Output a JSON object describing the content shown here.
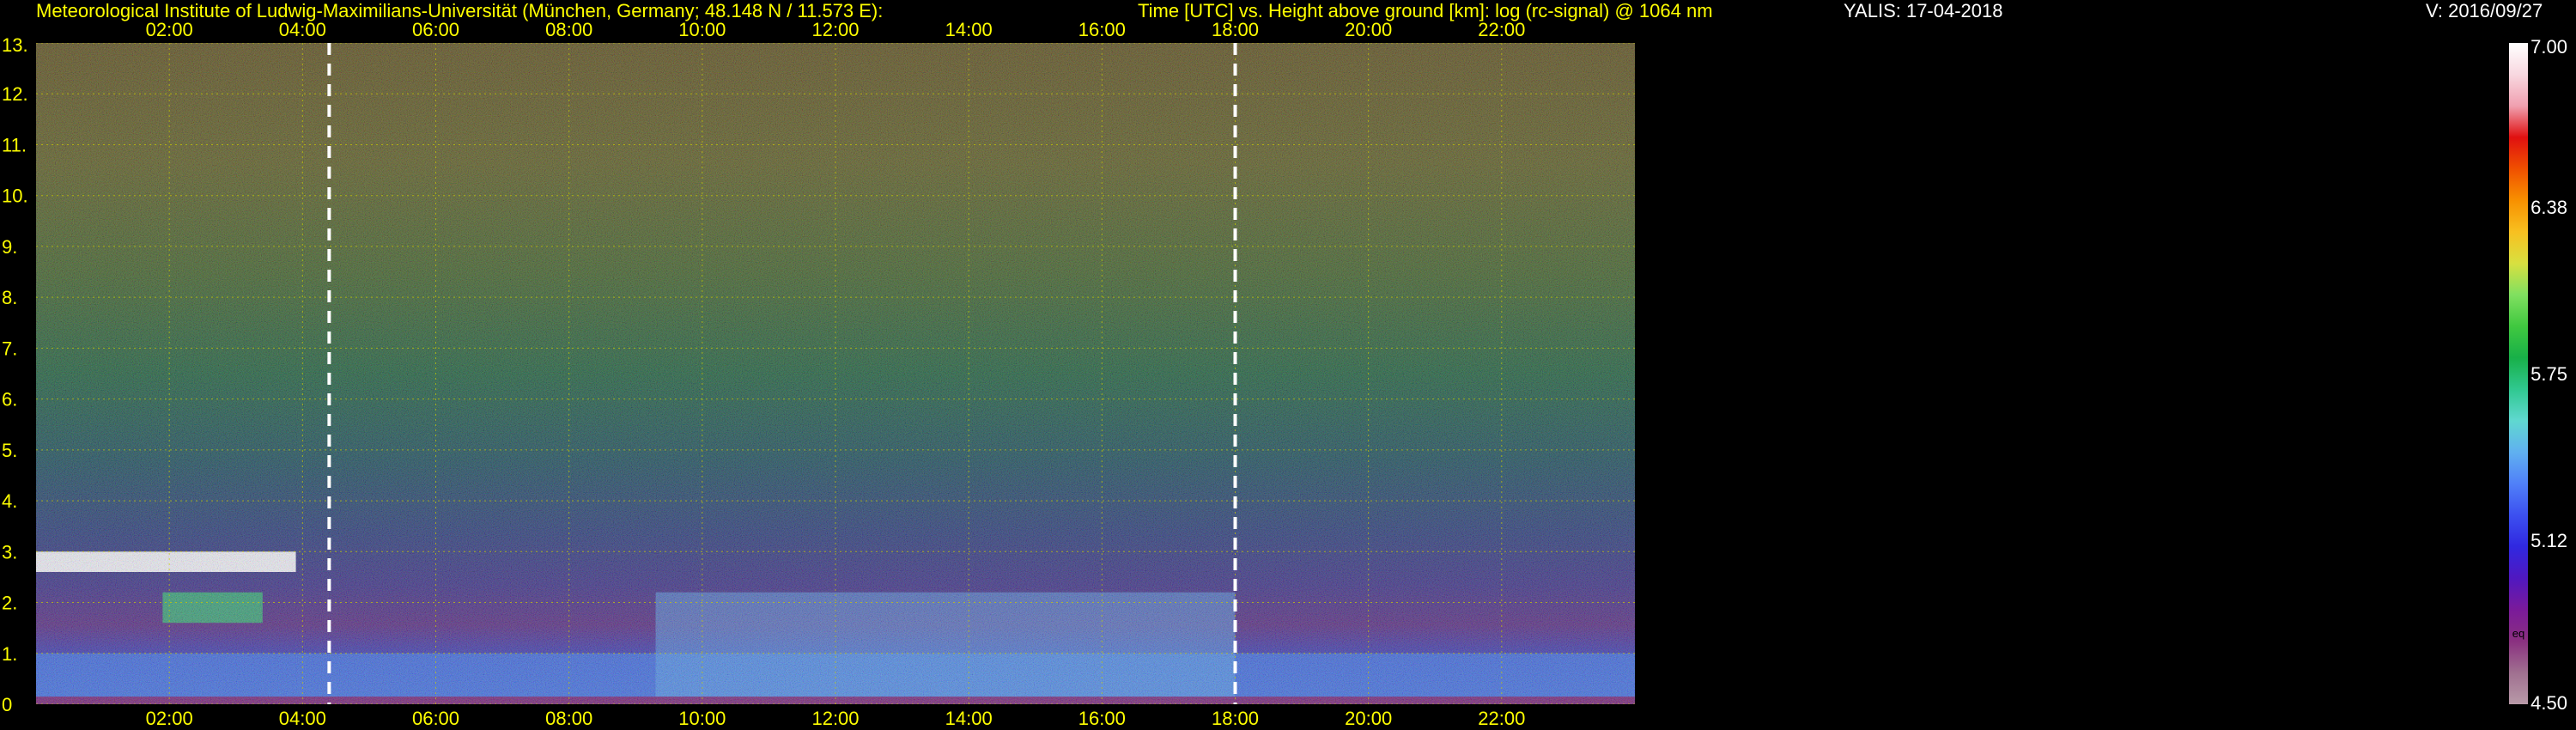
{
  "header": {
    "institute": "Meteorological Institute of Ludwig-Maximilians-Universität (München, Germany; 48.148 N / 11.573 E):",
    "plot_title": "Time [UTC] vs. Height above ground [km]: log (rc-signal) @ 1064 nm",
    "station_date": "YALIS: 17-04-2018",
    "version": "V: 2016/09/27"
  },
  "chart_data": {
    "type": "heatmap",
    "title": "Time [UTC] vs. Height above ground [km]: log (rc-signal) @ 1064 nm",
    "x_ticks": [
      "02:00",
      "04:00",
      "06:00",
      "08:00",
      "10:00",
      "12:00",
      "14:00",
      "16:00",
      "18:00",
      "20:00",
      "22:00"
    ],
    "x_tick_hours": [
      2,
      4,
      6,
      8,
      10,
      12,
      14,
      16,
      18,
      20,
      22
    ],
    "xlim_hours": [
      0,
      24
    ],
    "y_ticks": [
      "0",
      "1.",
      "2.",
      "3.",
      "4.",
      "5.",
      "6.",
      "7.",
      "8.",
      "9.",
      "10.",
      "11.",
      "12.",
      "13."
    ],
    "ylim_km": [
      0,
      13
    ],
    "grid": true,
    "dashed_markers_hours": [
      4.4,
      18.0
    ],
    "colorbar": {
      "range": [
        4.5,
        7.0
      ],
      "tick_labels": [
        "4.50",
        "5.12",
        "5.75",
        "6.38",
        "7.00"
      ],
      "tick_values": [
        4.5,
        5.12,
        5.75,
        6.38,
        7.0
      ],
      "note": "eq",
      "colors": [
        "#b89aa8",
        "#a07090",
        "#8a3080",
        "#7a1a9a",
        "#5018c0",
        "#3028e0",
        "#3c50f0",
        "#5080f8",
        "#60b0f0",
        "#60d8d0",
        "#30c890",
        "#18b048",
        "#40c840",
        "#80e060",
        "#d8e040",
        "#f8c020",
        "#f89000",
        "#f05000",
        "#e01010",
        "#f0a0b0",
        "#f8d8e0",
        "#ffffff"
      ]
    },
    "layers": [
      {
        "name": "residual_layer",
        "from_hour": 0,
        "to_hour": 24,
        "top_km": 1.0
      },
      {
        "name": "convective_boundary_layer",
        "from_hour": 9.3,
        "to_hour": 18.0,
        "top_km": 2.2
      },
      {
        "name": "lofted_cloud_layer",
        "from_hour": 0.0,
        "to_hour": 3.9,
        "base_km": 2.6,
        "top_km": 3.0
      },
      {
        "name": "low_cloud_layer",
        "from_hour": 1.9,
        "to_hour": 3.4,
        "base_km": 1.6,
        "top_km": 2.2
      }
    ]
  }
}
